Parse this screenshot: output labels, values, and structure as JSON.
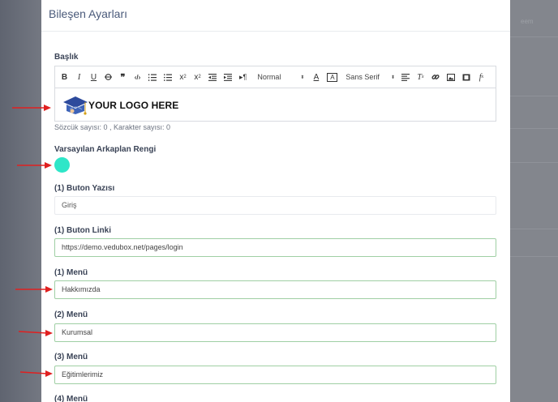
{
  "modal": {
    "title": "Bileşen Ayarları"
  },
  "background": {
    "right_text": "eem"
  },
  "editor": {
    "label": "Başlık",
    "toolbar": {
      "header_select": "Normal",
      "font_select": "Sans Serif",
      "buttons": [
        "bold-icon",
        "italic-icon",
        "underline-icon",
        "strikethrough-icon",
        "blockquote-icon",
        "code-icon",
        "ordered-list-icon",
        "bullet-list-icon",
        "subscript-icon",
        "superscript-icon",
        "outdent-icon",
        "indent-icon",
        "text-direction-icon",
        "text-color-icon",
        "background-color-icon",
        "align-icon",
        "clean-format-icon",
        "link-icon",
        "image-icon",
        "video-icon",
        "formula-icon"
      ]
    },
    "content_text": "YOUR LOGO HERE",
    "word_count": "Sözcük sayısı: 0 , Karakter sayısı: 0"
  },
  "bg_color": {
    "label": "Varsayılan Arkaplan Rengi",
    "value": "#2ee6c8"
  },
  "fields": {
    "button_text": {
      "label": "(1) Buton Yazısı",
      "value": "Giriş"
    },
    "button_link": {
      "label": "(1) Buton Linki",
      "value": "https://demo.vedubox.net/pages/login"
    },
    "menu1": {
      "label": "(1) Menü",
      "value": "Hakkımızda"
    },
    "menu2": {
      "label": "(2) Menü",
      "value": "Kurumsal"
    },
    "menu3": {
      "label": "(3) Menü",
      "value": "Eğitimlerimiz"
    },
    "menu4": {
      "label": "(4) Menü"
    }
  },
  "colors": {
    "arrow": "#e02020",
    "accent": "#2ee6c8",
    "title": "#4a5a7a",
    "focus_border": "#9fcfa4"
  }
}
